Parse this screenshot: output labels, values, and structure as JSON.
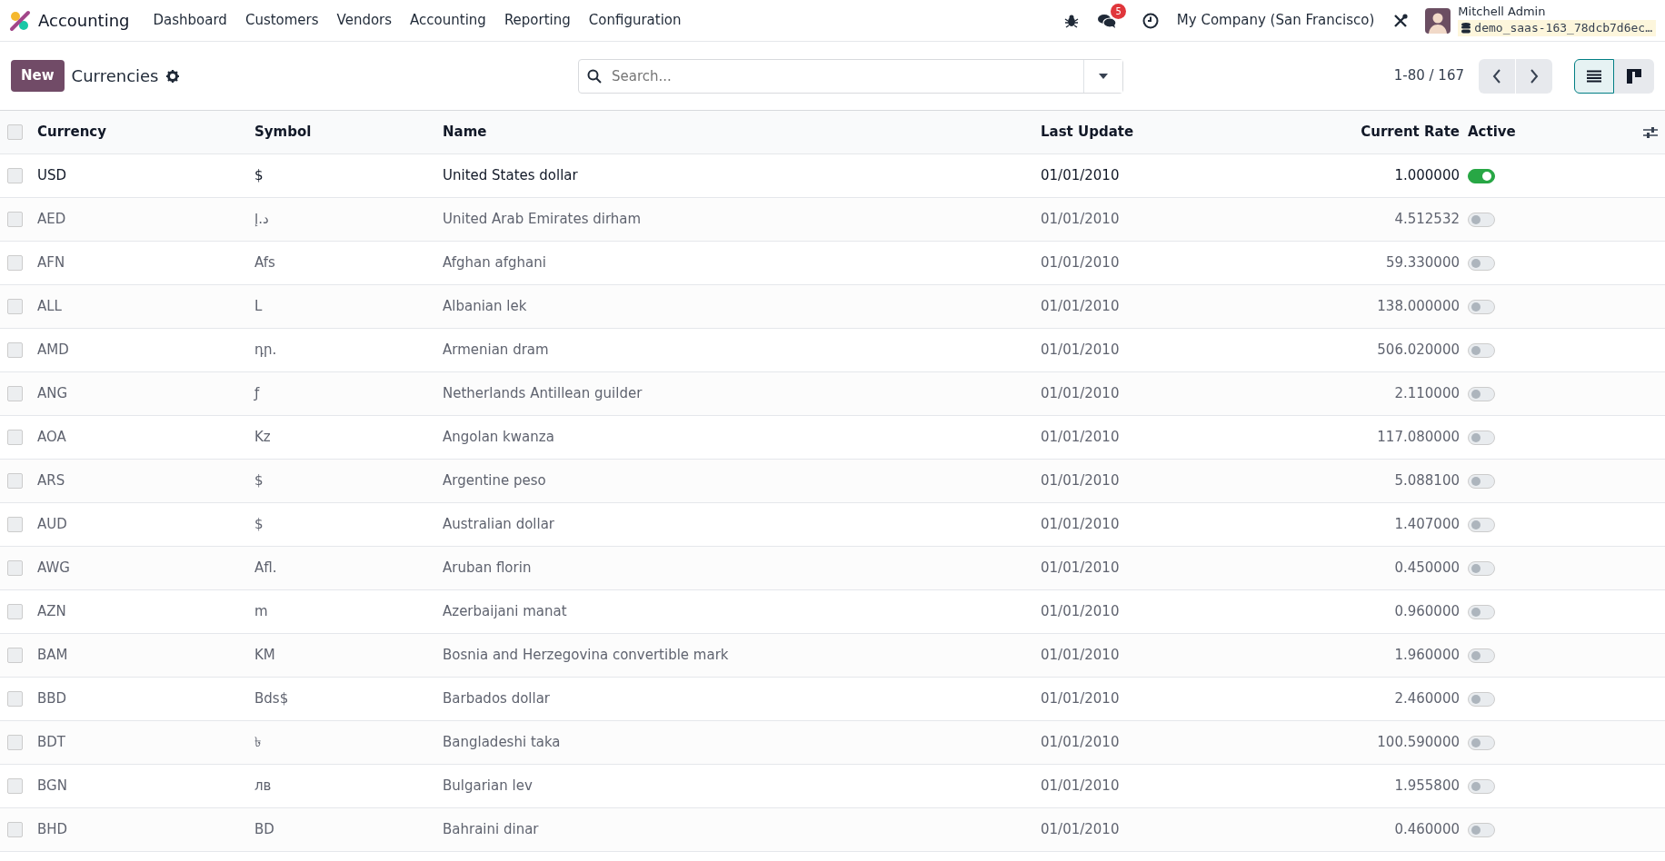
{
  "navbar": {
    "app_name": "Accounting",
    "menu": [
      "Dashboard",
      "Customers",
      "Vendors",
      "Accounting",
      "Reporting",
      "Configuration"
    ],
    "chat_badge": "5",
    "company": "My Company (San Francisco)",
    "user": {
      "name": "Mitchell Admin",
      "database": "demo_saas-163_78dcb7d6ec…"
    }
  },
  "control_panel": {
    "new_button": "New",
    "title": "Currencies",
    "search": {
      "placeholder": "Search..."
    },
    "pager": "1-80 / 167",
    "views": [
      {
        "kind": "list",
        "selected": true
      },
      {
        "kind": "kanban",
        "selected": false
      }
    ]
  },
  "table": {
    "select_all_checked": false,
    "columns": [
      "Currency",
      "Symbol",
      "Name",
      "Last Update",
      "Current Rate",
      "Active"
    ],
    "rows": [
      {
        "currency": "USD",
        "symbol": "$",
        "name": "United States dollar",
        "last_update": "01/01/2010",
        "rate": "1.000000",
        "active": true,
        "selected": false
      },
      {
        "currency": "AED",
        "symbol": "د.إ",
        "name": "United Arab Emirates dirham",
        "last_update": "01/01/2010",
        "rate": "4.512532",
        "active": false,
        "selected": false
      },
      {
        "currency": "AFN",
        "symbol": "Afs",
        "name": "Afghan afghani",
        "last_update": "01/01/2010",
        "rate": "59.330000",
        "active": false,
        "selected": false
      },
      {
        "currency": "ALL",
        "symbol": "L",
        "name": "Albanian lek",
        "last_update": "01/01/2010",
        "rate": "138.000000",
        "active": false,
        "selected": false
      },
      {
        "currency": "AMD",
        "symbol": "դր.",
        "name": "Armenian dram",
        "last_update": "01/01/2010",
        "rate": "506.020000",
        "active": false,
        "selected": false
      },
      {
        "currency": "ANG",
        "symbol": "ƒ",
        "name": "Netherlands Antillean guilder",
        "last_update": "01/01/2010",
        "rate": "2.110000",
        "active": false,
        "selected": false
      },
      {
        "currency": "AOA",
        "symbol": "Kz",
        "name": "Angolan kwanza",
        "last_update": "01/01/2010",
        "rate": "117.080000",
        "active": false,
        "selected": false
      },
      {
        "currency": "ARS",
        "symbol": "$",
        "name": "Argentine peso",
        "last_update": "01/01/2010",
        "rate": "5.088100",
        "active": false,
        "selected": false
      },
      {
        "currency": "AUD",
        "symbol": "$",
        "name": "Australian dollar",
        "last_update": "01/01/2010",
        "rate": "1.407000",
        "active": false,
        "selected": false
      },
      {
        "currency": "AWG",
        "symbol": "Afl.",
        "name": "Aruban florin",
        "last_update": "01/01/2010",
        "rate": "0.450000",
        "active": false,
        "selected": false
      },
      {
        "currency": "AZN",
        "symbol": "m",
        "name": "Azerbaijani manat",
        "last_update": "01/01/2010",
        "rate": "0.960000",
        "active": false,
        "selected": false
      },
      {
        "currency": "BAM",
        "symbol": "KM",
        "name": "Bosnia and Herzegovina convertible mark",
        "last_update": "01/01/2010",
        "rate": "1.960000",
        "active": false,
        "selected": false
      },
      {
        "currency": "BBD",
        "symbol": "Bds$",
        "name": "Barbados dollar",
        "last_update": "01/01/2010",
        "rate": "2.460000",
        "active": false,
        "selected": false
      },
      {
        "currency": "BDT",
        "symbol": "৳",
        "name": "Bangladeshi taka",
        "last_update": "01/01/2010",
        "rate": "100.590000",
        "active": false,
        "selected": false
      },
      {
        "currency": "BGN",
        "symbol": "лв",
        "name": "Bulgarian lev",
        "last_update": "01/01/2010",
        "rate": "1.955800",
        "active": false,
        "selected": false
      },
      {
        "currency": "BHD",
        "symbol": "BD",
        "name": "Bahraini dinar",
        "last_update": "01/01/2010",
        "rate": "0.460000",
        "active": false,
        "selected": false
      }
    ]
  }
}
